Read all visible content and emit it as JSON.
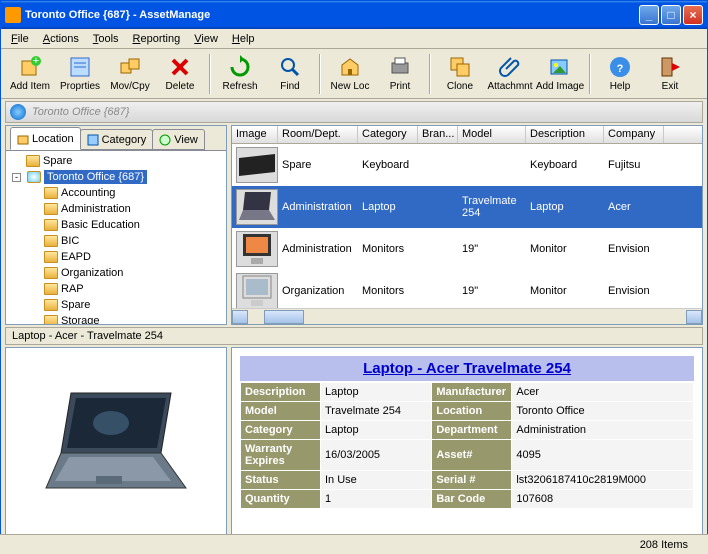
{
  "window": {
    "title": "Toronto Office {687} - AssetManage"
  },
  "menu": [
    "File",
    "Actions",
    "Tools",
    "Reporting",
    "View",
    "Help"
  ],
  "toolbar": [
    {
      "label": "Add Item"
    },
    {
      "label": "Proprties"
    },
    {
      "label": "Mov/Cpy"
    },
    {
      "label": "Delete",
      "sep": true
    },
    {
      "label": "Refresh"
    },
    {
      "label": "Find",
      "sep": true
    },
    {
      "label": "New Loc"
    },
    {
      "label": "Print",
      "sep": true
    },
    {
      "label": "Clone"
    },
    {
      "label": "Attachmnt"
    },
    {
      "label": "Add Image",
      "sep": true
    },
    {
      "label": "Help"
    },
    {
      "label": "Exit"
    }
  ],
  "location_title": "Toronto Office {687}",
  "tabs": [
    {
      "label": "Location",
      "active": true
    },
    {
      "label": "Category"
    },
    {
      "label": "View"
    }
  ],
  "tree": [
    {
      "label": "Spare",
      "level": 1
    },
    {
      "label": "Toronto Office {687}",
      "level": 1,
      "selected": true,
      "expand": "-",
      "home": true
    },
    {
      "label": "Accounting",
      "level": 2
    },
    {
      "label": "Administration",
      "level": 2
    },
    {
      "label": "Basic Education",
      "level": 2
    },
    {
      "label": "BIC",
      "level": 2
    },
    {
      "label": "EAPD",
      "level": 2
    },
    {
      "label": "Organization",
      "level": 2
    },
    {
      "label": "RAP",
      "level": 2
    },
    {
      "label": "Spare",
      "level": 2
    },
    {
      "label": "Storage",
      "level": 2
    }
  ],
  "grid": {
    "headers": [
      "Image",
      "Room/Dept.",
      "Category",
      "Bran...",
      "Model",
      "Description",
      "Company"
    ],
    "rows": [
      {
        "room": "Spare",
        "cat": "Keyboard",
        "brand": "",
        "model": "",
        "desc": "Keyboard",
        "comp": "Fujitsu"
      },
      {
        "room": "Administration",
        "cat": "Laptop",
        "brand": "",
        "model": "Travelmate 254",
        "desc": "Laptop",
        "comp": "Acer",
        "selected": true
      },
      {
        "room": "Administration",
        "cat": "Monitors",
        "brand": "",
        "model": "19\"",
        "desc": "Monitor",
        "comp": "Envision"
      },
      {
        "room": "Organization",
        "cat": "Monitors",
        "brand": "",
        "model": "19\"",
        "desc": "Monitor",
        "comp": "Envision"
      }
    ]
  },
  "breadcrumb": "Laptop - Acer - Travelmate 254",
  "detail": {
    "title": "Laptop - Acer Travelmate 254",
    "rows": [
      [
        {
          "k": "Description",
          "v": "Laptop"
        },
        {
          "k": "Manufacturer",
          "v": "Acer"
        }
      ],
      [
        {
          "k": "Model",
          "v": "Travelmate 254"
        },
        {
          "k": "Location",
          "v": "Toronto Office"
        }
      ],
      [
        {
          "k": "Category",
          "v": "Laptop"
        },
        {
          "k": "Department",
          "v": "Administration"
        }
      ],
      [
        {
          "k": "Warranty Expires",
          "v": "16/03/2005"
        },
        {
          "k": "Asset#",
          "v": "4095"
        }
      ],
      [
        {
          "k": "Status",
          "v": "In Use"
        },
        {
          "k": "Serial #",
          "v": "lst3206187410c2819M000"
        }
      ],
      [
        {
          "k": "Quantity",
          "v": "1"
        },
        {
          "k": "Bar Code",
          "v": "107608"
        }
      ]
    ]
  },
  "status": "208 Items"
}
